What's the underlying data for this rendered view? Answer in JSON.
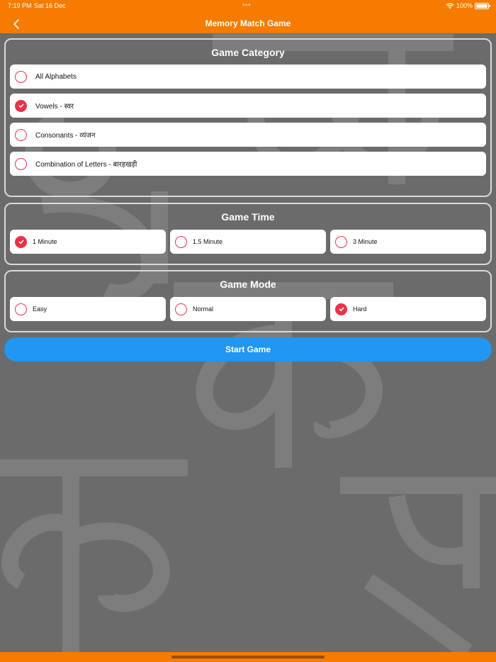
{
  "status_bar": {
    "time": "7:19 PM",
    "date": "Sat 16 Dec",
    "dots": "•••",
    "battery": "100%"
  },
  "nav": {
    "title": "Memory Match Game",
    "back_icon": "chevron-left-icon"
  },
  "colors": {
    "accent": "#f57c00",
    "radio": "#e8334a",
    "button": "#2196f3",
    "background": "#6b6b6b"
  },
  "category": {
    "title": "Game Category",
    "options": [
      {
        "label": "All Alphabets",
        "checked": false
      },
      {
        "label": "Vowels - स्वर",
        "checked": true
      },
      {
        "label": "Consonants - व्यंजन",
        "checked": false
      },
      {
        "label": "Combination of Letters - बारहखड़ी",
        "checked": false
      }
    ]
  },
  "time": {
    "title": "Game Time",
    "options": [
      {
        "label": "1 Minute",
        "checked": true
      },
      {
        "label": "1.5 Minute",
        "checked": false
      },
      {
        "label": "3 Minute",
        "checked": false
      }
    ]
  },
  "mode": {
    "title": "Game Mode",
    "options": [
      {
        "label": "Easy",
        "checked": false
      },
      {
        "label": "Normal",
        "checked": false
      },
      {
        "label": "Hard",
        "checked": true
      }
    ]
  },
  "start_button": {
    "label": "Start Game"
  }
}
